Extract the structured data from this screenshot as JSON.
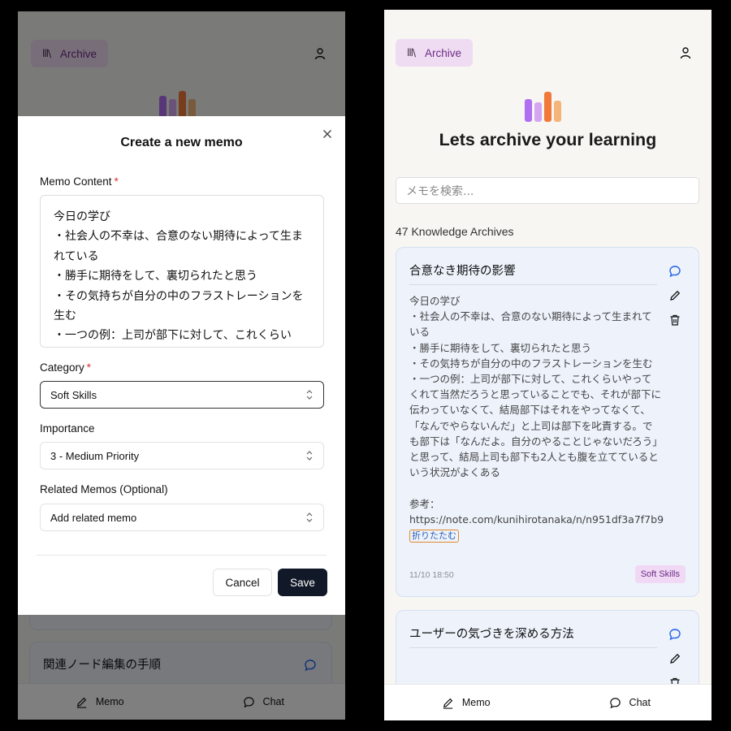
{
  "app": {
    "archive_label": "Archive",
    "heading": "Lets archive your learning",
    "search_placeholder": "メモを検索...",
    "archive_count": "47 Knowledge Archives",
    "brand_colors": [
      "#b06ef0",
      "#d4a6f2",
      "#f07a3a",
      "#f5b47a"
    ]
  },
  "nav": {
    "memo": "Memo",
    "chat": "Chat"
  },
  "modal": {
    "title": "Create a new memo",
    "content_label": "Memo Content",
    "content_value": "今日の学び\n・社会人の不幸は、合意のない期待によって生まれている\n・勝手に期待をして、裏切られたと思う\n・その気持ちが自分の中のフラストレーションを生む\n・一つの例：上司が部下に対して、これくらい",
    "category_label": "Category",
    "category_value": "Soft Skills",
    "importance_label": "Importance",
    "importance_value": "3 - Medium Priority",
    "related_label": "Related Memos (Optional)",
    "related_value": "Add related memo",
    "required_mark": "*",
    "cancel_label": "Cancel",
    "save_label": "Save"
  },
  "background_card": {
    "title": "関連ノード編集の手順"
  },
  "cards": [
    {
      "title": "合意なき期待の影響",
      "body": "今日の学び\n・社会人の不幸は、合意のない期待によって生まれている\n・勝手に期待をして、裏切られたと思う\n・その気持ちが自分の中のフラストレーションを生む\n・一つの例：上司が部下に対して、これくらいやってくれて当然だろうと思っていることでも、それが部下に伝わっていなくて、結局部下はそれをやってなくて、「なんでやらないんだ」と上司は部下を叱責する。でも部下は「なんだよ。自分のやることじゃないだろう」と思って、結局上司も部下も2人とも腹を立てているという状況がよくある\n\n参考：\nhttps://note.com/kunihirotanaka/n/n951df3a7f7b9",
      "fold_label": "折りたたむ",
      "date": "11/10 18:50",
      "tag": "Soft Skills"
    },
    {
      "title": "ユーザーの気づきを深める方法"
    }
  ]
}
